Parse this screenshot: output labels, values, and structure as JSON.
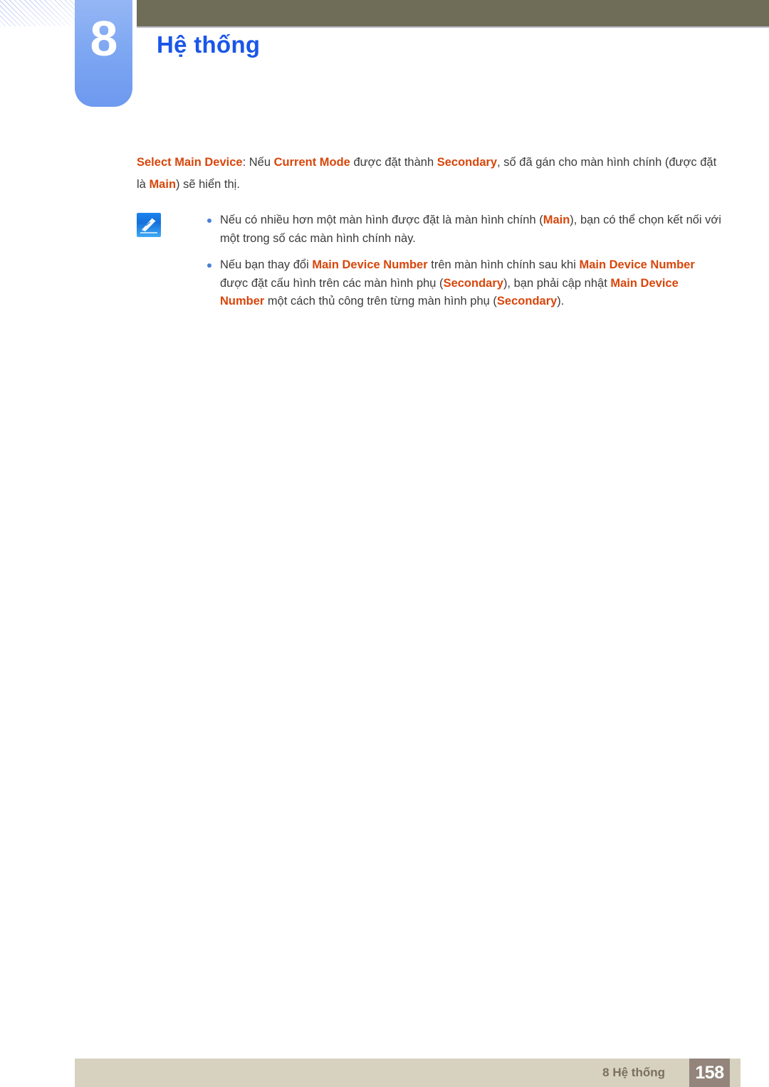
{
  "header": {
    "chapter_number": "8",
    "chapter_title": "Hệ thống",
    "bar_color": "#6f6d58",
    "badge_color": "#7fa8f2",
    "title_color": "#1a56e8"
  },
  "content": {
    "accent_color": "#d8460b",
    "intro": {
      "seg1_kw": "Select Main Device",
      "seg2": ": Nếu ",
      "seg3_kw": "Current Mode",
      "seg4": " được đặt thành ",
      "seg5_kw": "Secondary",
      "seg6": ", số đã gán cho màn hình chính (được đặt là ",
      "seg7_kw": "Main",
      "seg8": ") sẽ hiển thị."
    },
    "note": {
      "icon": "note-pencil-icon",
      "bullets": [
        {
          "seg1": "Nếu có nhiều hơn một màn hình được đặt là màn hình chính (",
          "seg2_kw": "Main",
          "seg3": "), bạn có thể chọn kết nối với một trong số các màn hình chính này."
        },
        {
          "seg1": "Nếu bạn thay đổi ",
          "seg2_kw": "Main Device Number",
          "seg3": " trên màn hình chính sau khi ",
          "seg4_kw": "Main Device Number",
          "seg5": " được đặt cấu hình trên các màn hình phụ (",
          "seg6_kw": "Secondary",
          "seg7": "), bạn phải cập nhật ",
          "seg8_kw": "Main Device Number",
          "seg9": " một cách thủ công trên từng màn hình phụ (",
          "seg10_kw": "Secondary",
          "seg11": ")."
        }
      ]
    }
  },
  "footer": {
    "label": "8 Hệ thống",
    "page_number": "158",
    "bar_color": "#d6d2bf",
    "page_box_color": "#93857c"
  }
}
